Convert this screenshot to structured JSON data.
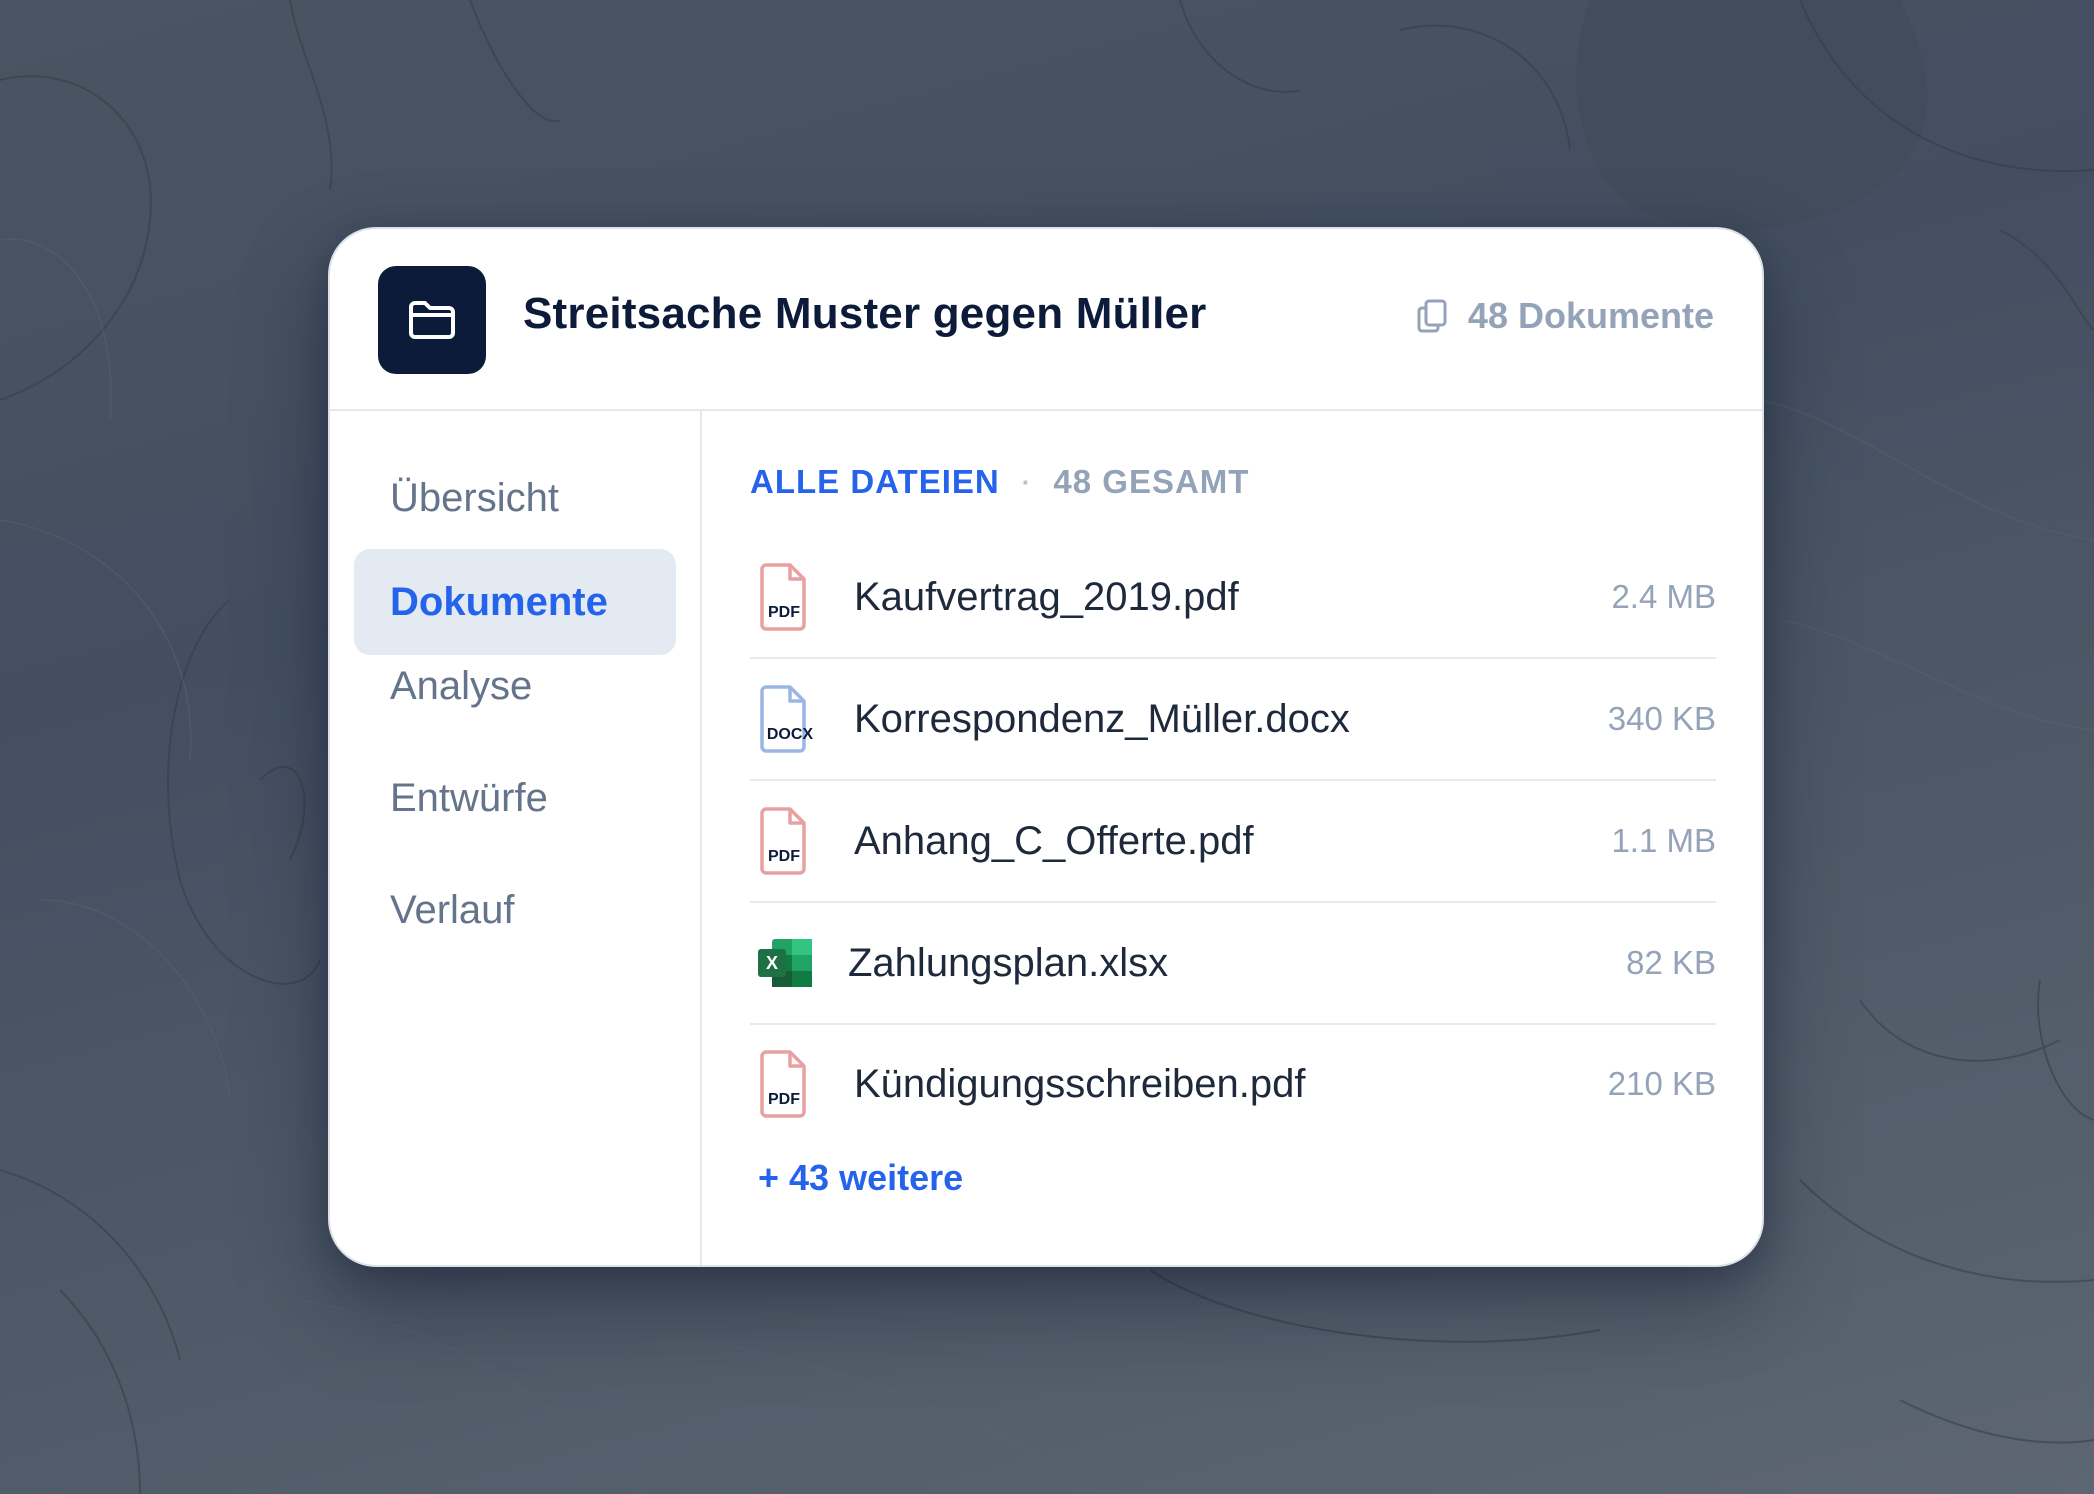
{
  "case": {
    "icon": "folder-icon",
    "title": "Streitsache Muster gegen Müller",
    "doc_count_icon": "copy-icon",
    "doc_count_label": "48 Dokumente"
  },
  "sidebar": {
    "items": [
      {
        "label": "Übersicht",
        "active": false
      },
      {
        "label": "Dokumente",
        "active": true
      },
      {
        "label": "Analyse",
        "active": false
      },
      {
        "label": "Entwürfe",
        "active": false
      },
      {
        "label": "Verlauf",
        "active": false
      }
    ]
  },
  "files_section": {
    "heading": "ALLE DATEIEN",
    "separator": "·",
    "total": "48 GESAMT",
    "files": [
      {
        "name": "Kaufvertrag_2019.pdf",
        "size": "2.4 MB",
        "type": "PDF",
        "icon": "pdf-file-icon"
      },
      {
        "name": "Korrespondenz_Müller.docx",
        "size": "340 KB",
        "type": "DOCX",
        "icon": "docx-file-icon"
      },
      {
        "name": "Anhang_C_Offerte.pdf",
        "size": "1.1 MB",
        "type": "PDF",
        "icon": "pdf-file-icon"
      },
      {
        "name": "Zahlungsplan.xlsx",
        "size": "82 KB",
        "type": "X",
        "icon": "excel-file-icon"
      },
      {
        "name": "Kündigungsschreiben.pdf",
        "size": "210 KB",
        "type": "PDF",
        "icon": "pdf-file-icon"
      }
    ],
    "more_label": "+ 43 weitere"
  },
  "colors": {
    "accent": "#2563eb",
    "navy": "#0d1b3a",
    "pdf": "#e8a0a0",
    "docx": "#9bb5e6",
    "excel": "#1e7145",
    "muted": "#94a3b8"
  }
}
